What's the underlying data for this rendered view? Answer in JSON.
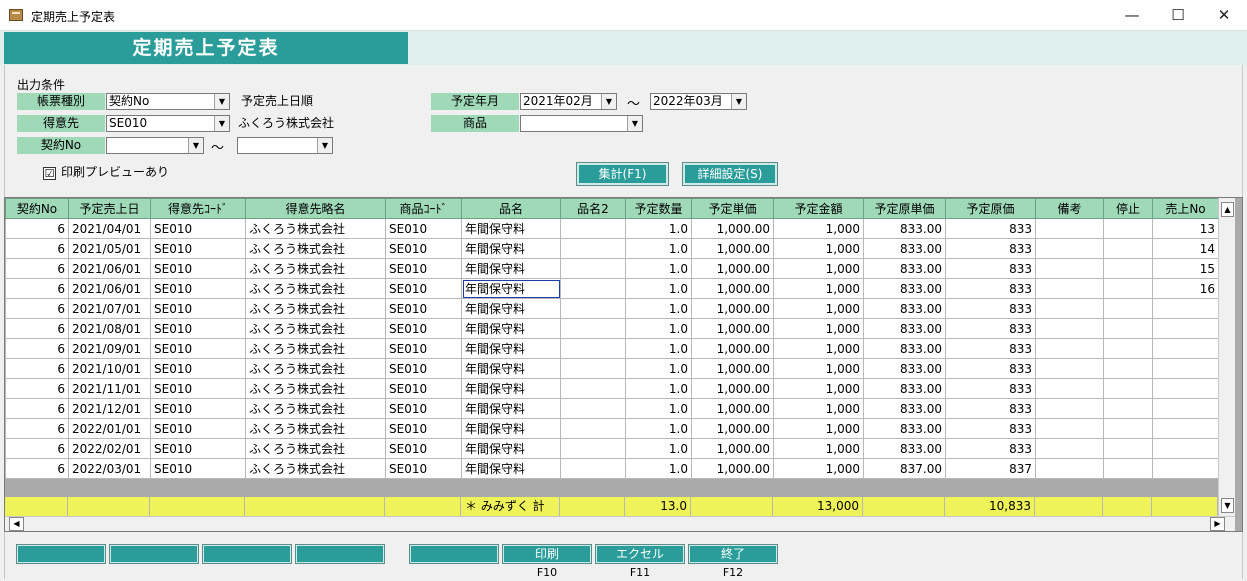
{
  "window": {
    "title": "定期売上予定表",
    "minimize": "—",
    "maximize": "☐",
    "close": "✕"
  },
  "header": {
    "title": "定期売上予定表"
  },
  "conditions": {
    "section_label": "出力条件",
    "report_type": {
      "label": "帳票種別",
      "value": "契約No",
      "note": "予定売上日順"
    },
    "customer": {
      "label": "得意先",
      "value": "SE010",
      "name": "ふくろう株式会社"
    },
    "contract": {
      "label": "契約No",
      "from": "",
      "to": ""
    },
    "period": {
      "label": "予定年月",
      "from": "2021年02月",
      "to": "2022年03月"
    },
    "product": {
      "label": "商品",
      "value": ""
    },
    "tilde": "～",
    "print_preview": {
      "label": "印刷プレビューあり",
      "checked": "☑"
    }
  },
  "buttons": {
    "aggregate": "集計(F1)",
    "detail": "詳細設定(S)"
  },
  "grid": {
    "columns": [
      "契約No",
      "予定売上日",
      "得意先ｺｰﾄﾞ",
      "得意先略名",
      "商品ｺｰﾄﾞ",
      "品名",
      "品名2",
      "予定数量",
      "予定単価",
      "予定金額",
      "予定原単価",
      "予定原価",
      "備考",
      "停止",
      "売上No"
    ],
    "rows": [
      [
        "6",
        "2021/04/01",
        "SE010",
        "ふくろう株式会社",
        "SE010",
        "年間保守料",
        "",
        "1.0",
        "1,000.00",
        "1,000",
        "833.00",
        "833",
        "",
        "",
        "13"
      ],
      [
        "6",
        "2021/05/01",
        "SE010",
        "ふくろう株式会社",
        "SE010",
        "年間保守料",
        "",
        "1.0",
        "1,000.00",
        "1,000",
        "833.00",
        "833",
        "",
        "",
        "14"
      ],
      [
        "6",
        "2021/06/01",
        "SE010",
        "ふくろう株式会社",
        "SE010",
        "年間保守料",
        "",
        "1.0",
        "1,000.00",
        "1,000",
        "833.00",
        "833",
        "",
        "",
        "15"
      ],
      [
        "6",
        "2021/06/01",
        "SE010",
        "ふくろう株式会社",
        "SE010",
        "年間保守料",
        "",
        "1.0",
        "1,000.00",
        "1,000",
        "833.00",
        "833",
        "",
        "",
        "16"
      ],
      [
        "6",
        "2021/07/01",
        "SE010",
        "ふくろう株式会社",
        "SE010",
        "年間保守料",
        "",
        "1.0",
        "1,000.00",
        "1,000",
        "833.00",
        "833",
        "",
        "",
        ""
      ],
      [
        "6",
        "2021/08/01",
        "SE010",
        "ふくろう株式会社",
        "SE010",
        "年間保守料",
        "",
        "1.0",
        "1,000.00",
        "1,000",
        "833.00",
        "833",
        "",
        "",
        ""
      ],
      [
        "6",
        "2021/09/01",
        "SE010",
        "ふくろう株式会社",
        "SE010",
        "年間保守料",
        "",
        "1.0",
        "1,000.00",
        "1,000",
        "833.00",
        "833",
        "",
        "",
        ""
      ],
      [
        "6",
        "2021/10/01",
        "SE010",
        "ふくろう株式会社",
        "SE010",
        "年間保守料",
        "",
        "1.0",
        "1,000.00",
        "1,000",
        "833.00",
        "833",
        "",
        "",
        ""
      ],
      [
        "6",
        "2021/11/01",
        "SE010",
        "ふくろう株式会社",
        "SE010",
        "年間保守料",
        "",
        "1.0",
        "1,000.00",
        "1,000",
        "833.00",
        "833",
        "",
        "",
        ""
      ],
      [
        "6",
        "2021/12/01",
        "SE010",
        "ふくろう株式会社",
        "SE010",
        "年間保守料",
        "",
        "1.0",
        "1,000.00",
        "1,000",
        "833.00",
        "833",
        "",
        "",
        ""
      ],
      [
        "6",
        "2022/01/01",
        "SE010",
        "ふくろう株式会社",
        "SE010",
        "年間保守料",
        "",
        "1.0",
        "1,000.00",
        "1,000",
        "833.00",
        "833",
        "",
        "",
        ""
      ],
      [
        "6",
        "2022/02/01",
        "SE010",
        "ふくろう株式会社",
        "SE010",
        "年間保守料",
        "",
        "1.0",
        "1,000.00",
        "1,000",
        "833.00",
        "833",
        "",
        "",
        ""
      ],
      [
        "6",
        "2022/03/01",
        "SE010",
        "ふくろう株式会社",
        "SE010",
        "年間保守料",
        "",
        "1.0",
        "1,000.00",
        "1,000",
        "837.00",
        "837",
        "",
        "",
        ""
      ]
    ],
    "total": {
      "label": "＊ みみずく 計",
      "qty": "13.0",
      "amount": "13,000",
      "cost": "10,833"
    }
  },
  "fkeys": [
    {
      "label": "",
      "key": ""
    },
    {
      "label": "",
      "key": ""
    },
    {
      "label": "",
      "key": ""
    },
    {
      "label": "",
      "key": ""
    },
    {
      "label": "",
      "key": ""
    },
    {
      "label": "印刷",
      "key": "F10"
    },
    {
      "label": "エクセル",
      "key": "F11"
    },
    {
      "label": "終了",
      "key": "F12"
    }
  ]
}
